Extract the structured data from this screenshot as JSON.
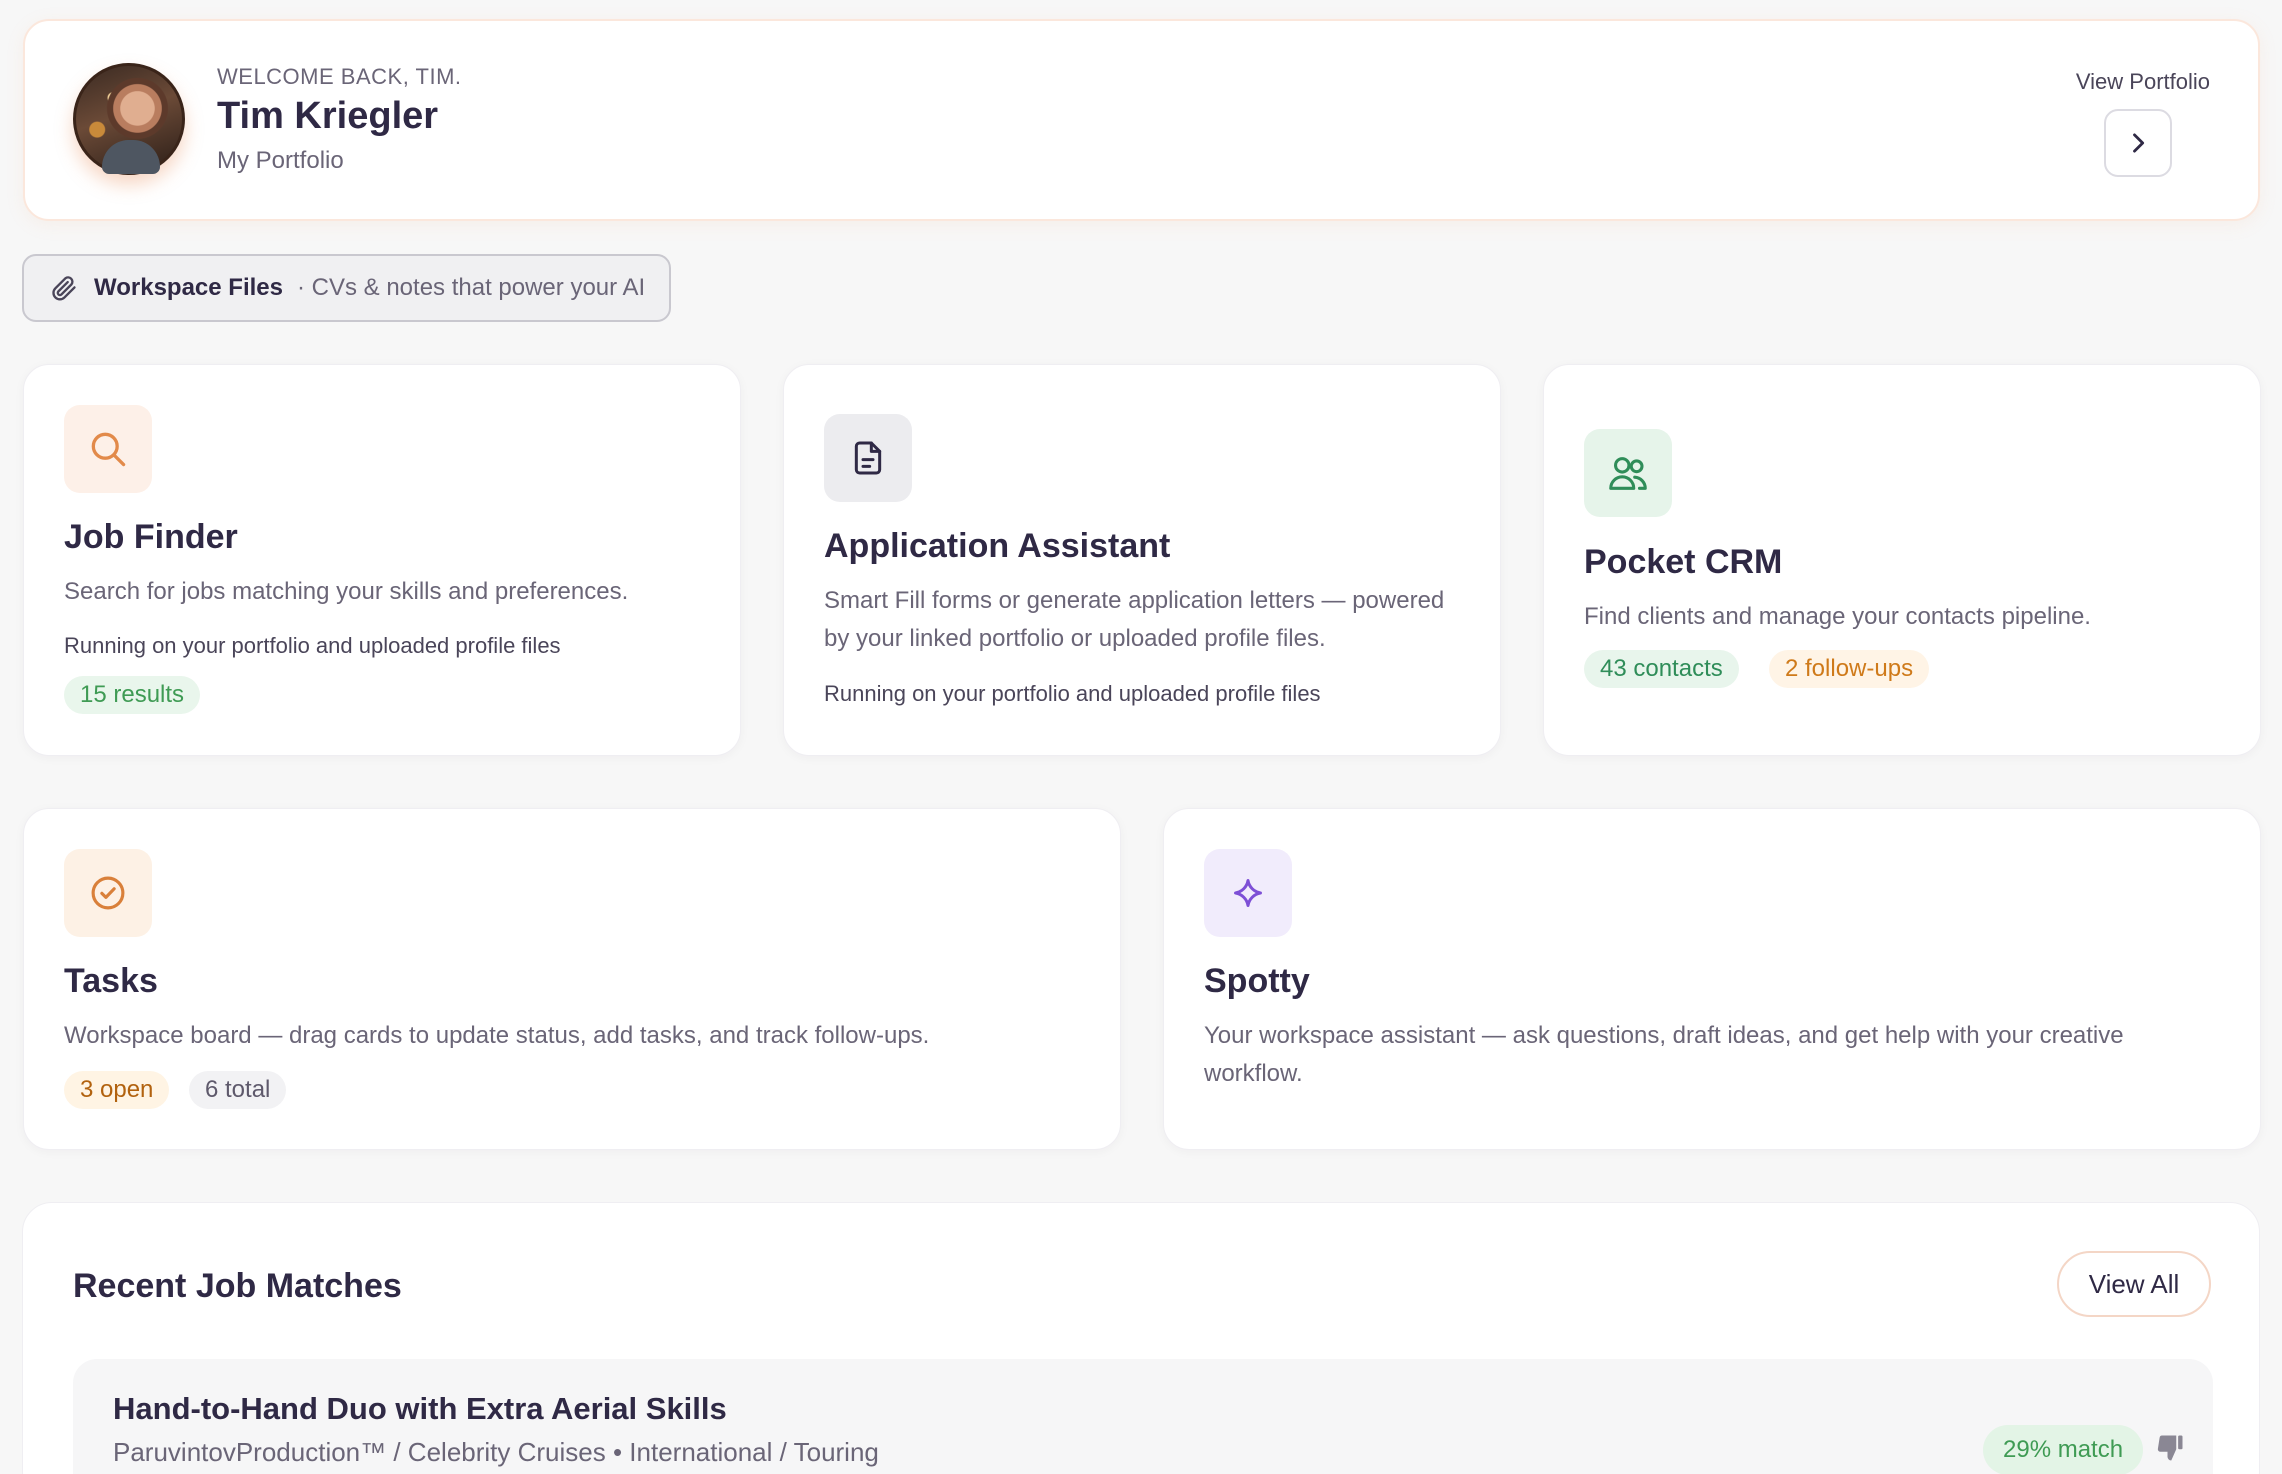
{
  "header": {
    "welcome": "WELCOME BACK, TIM.",
    "name": "Tim Kriegler",
    "subtitle": "My Portfolio",
    "view_portfolio": "View Portfolio"
  },
  "workspace_files": {
    "title": "Workspace Files",
    "description": "· CVs & notes that power your AI"
  },
  "cards": {
    "job_finder": {
      "title": "Job Finder",
      "description": "Search for jobs matching your skills and preferences.",
      "note": "Running on your portfolio and uploaded profile files",
      "badge": "15 results",
      "icon": "search-icon"
    },
    "application_assistant": {
      "title": "Application Assistant",
      "description": "Smart Fill forms or generate application letters — powered by your linked portfolio or uploaded profile files.",
      "note": "Running on your portfolio and uploaded profile files",
      "icon": "document-icon"
    },
    "pocket_crm": {
      "title": "Pocket CRM",
      "description": "Find clients and manage your contacts pipeline.",
      "badge_contacts": "43 contacts",
      "badge_followups": "2 follow-ups",
      "icon": "users-icon"
    },
    "tasks": {
      "title": "Tasks",
      "description": "Workspace board — drag cards to update status, add tasks, and track follow-ups.",
      "badge_open": "3 open",
      "badge_total": "6 total",
      "icon": "check-circle-icon"
    },
    "spotty": {
      "title": "Spotty",
      "description": "Your workspace assistant — ask questions, draft ideas, and get help with your creative workflow.",
      "icon": "sparkle-icon"
    }
  },
  "recent_matches": {
    "title": "Recent Job Matches",
    "view_all": "View All",
    "jobs": [
      {
        "title": "Hand-to-Hand Duo with Extra Aerial Skills",
        "company": "ParuvintovProduction™ / Celebrity Cruises • International / Touring",
        "match": "29% match"
      }
    ]
  },
  "colors": {
    "accent_orange": "#e28a4a",
    "green": "#3f9b54",
    "purple": "#7d4fd6"
  }
}
